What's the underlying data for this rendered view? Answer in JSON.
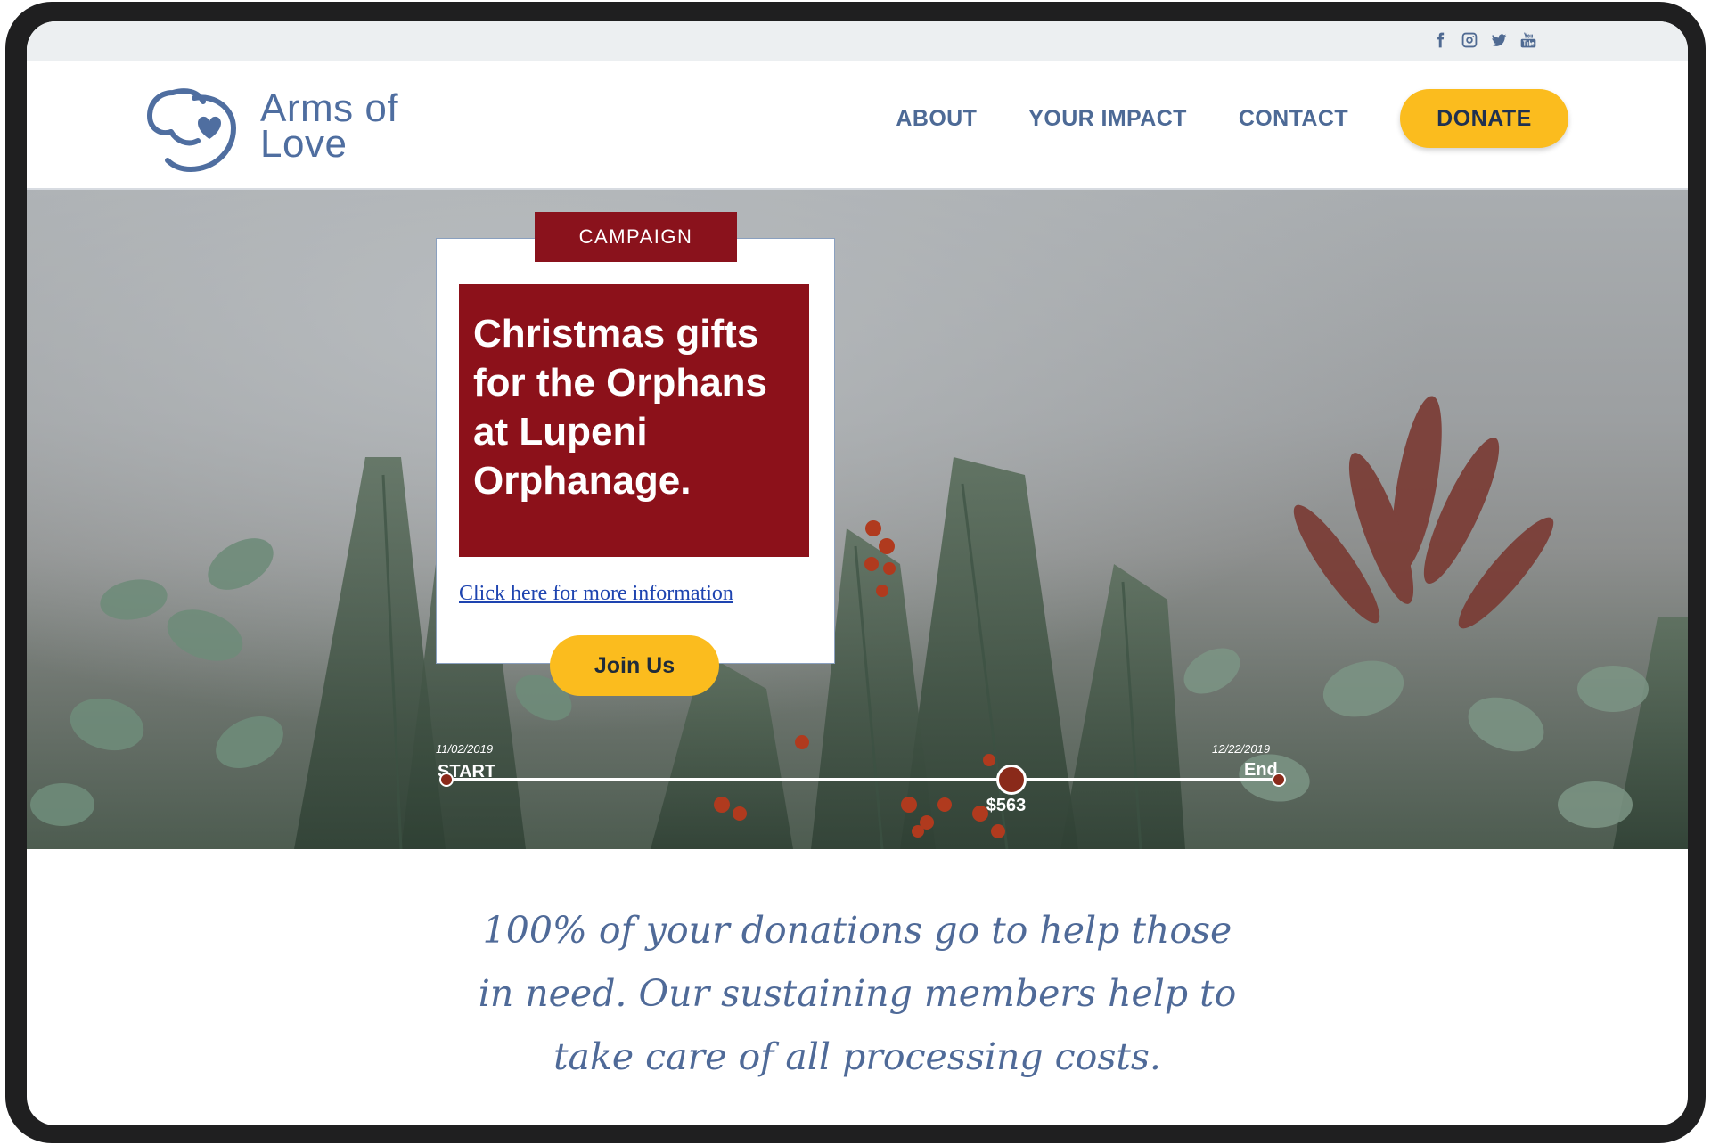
{
  "social": {
    "icons": [
      "facebook-icon",
      "instagram-icon",
      "twitter-icon",
      "youtube-icon"
    ]
  },
  "brand": {
    "name_line1": "Arms of",
    "name_line2": "Love",
    "color": "#4f6ea0"
  },
  "nav": {
    "items": [
      {
        "label": "ABOUT"
      },
      {
        "label": "YOUR IMPACT"
      },
      {
        "label": "CONTACT"
      }
    ],
    "donate_label": "DONATE"
  },
  "campaign": {
    "tag": "CAMPAIGN",
    "title": "Christmas gifts for the Orphans at Lupeni Orphanage.",
    "link_text": "Click here for more information",
    "join_label": "Join Us"
  },
  "progress": {
    "start_date": "11/02/2019",
    "start_label": "START",
    "end_date": "12/22/2019",
    "end_label": "End",
    "amount": "$563",
    "fraction": 0.68
  },
  "tagline": {
    "line1": "100% of your donations go to help those",
    "line2": "in need. Our sustaining members help to",
    "line3": "take care of all processing costs."
  },
  "colors": {
    "accent_yellow": "#fbbc1e",
    "campaign_red": "#8c111a",
    "nav_blue": "#4d6a96"
  }
}
